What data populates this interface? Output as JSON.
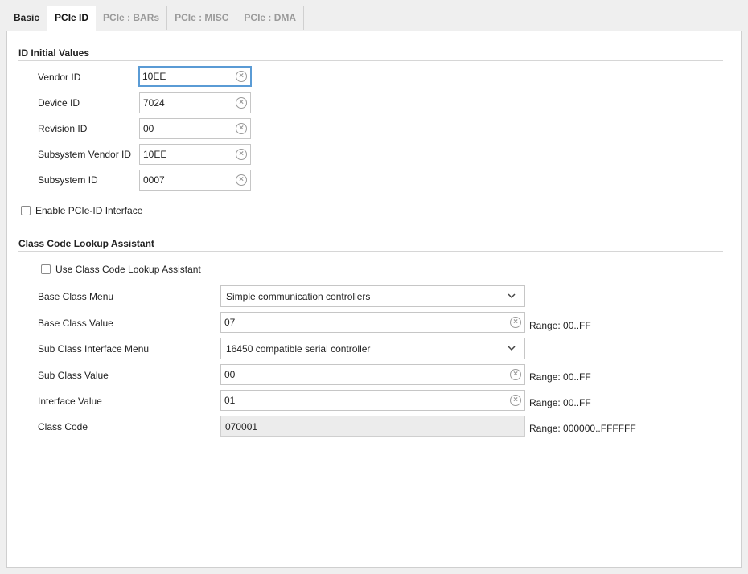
{
  "tabs": [
    {
      "label": "Basic",
      "state": "inactive"
    },
    {
      "label": "PCIe ID",
      "state": "active"
    },
    {
      "label": "PCIe : BARs",
      "state": "disabled"
    },
    {
      "label": "PCIe : MISC",
      "state": "disabled"
    },
    {
      "label": "PCIe : DMA",
      "state": "disabled"
    }
  ],
  "id_section": {
    "title": "ID Initial Values",
    "fields": [
      {
        "label": "Vendor ID",
        "value": "10EE"
      },
      {
        "label": "Device ID",
        "value": "7024"
      },
      {
        "label": "Revision ID",
        "value": "00"
      },
      {
        "label": "Subsystem Vendor ID",
        "value": "10EE"
      },
      {
        "label": "Subsystem ID",
        "value": "0007"
      }
    ],
    "enable_interface_label": "Enable PCIe-ID Interface"
  },
  "class_section": {
    "title": "Class Code Lookup Assistant",
    "use_assistant_label": "Use Class Code Lookup Assistant",
    "base_class_menu_label": "Base Class Menu",
    "base_class_menu_value": "Simple communication controllers",
    "base_class_value_label": "Base Class Value",
    "base_class_value": "07",
    "base_class_range": "Range: 00..FF",
    "sub_class_menu_label": "Sub Class Interface Menu",
    "sub_class_menu_value": "16450 compatible serial controller",
    "sub_class_value_label": "Sub Class Value",
    "sub_class_value": "00",
    "sub_class_range": "Range: 00..FF",
    "interface_value_label": "Interface Value",
    "interface_value": "01",
    "interface_range": "Range: 00..FF",
    "class_code_label": "Class Code",
    "class_code_value": "070001",
    "class_code_range": "Range: 000000..FFFFFF"
  },
  "icons": {
    "clear": "clear-circle-icon",
    "dropdown": "chevron-down-icon"
  },
  "colors": {
    "focus_border": "#5a9bd5",
    "disabled_tab_text": "#9a9a9a"
  }
}
